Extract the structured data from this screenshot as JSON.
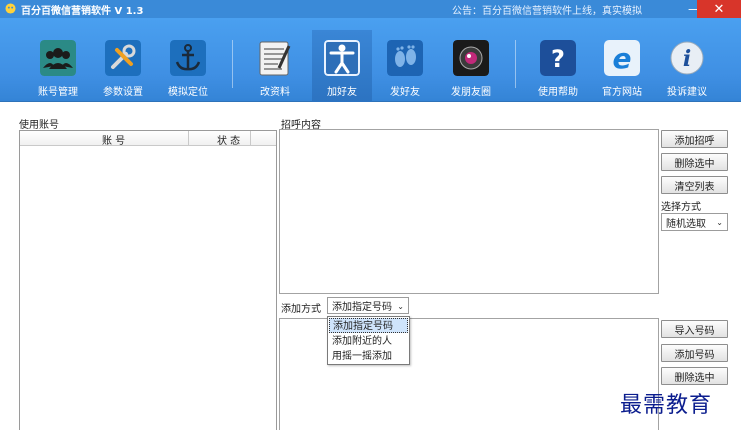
{
  "window": {
    "title": "百分百微信营销软件  V 1.3",
    "notice": "公告：百分百微信营销软件上线，真实模拟",
    "minimize_glyph": "—",
    "close_glyph": "✕"
  },
  "toolbar": {
    "items": [
      {
        "label": "账号管理",
        "icon": "users-icon"
      },
      {
        "label": "参数设置",
        "icon": "wrench-icon"
      },
      {
        "label": "模拟定位",
        "icon": "anchor-icon"
      },
      {
        "label": "改资料",
        "icon": "notepad-icon"
      },
      {
        "label": "加好友",
        "icon": "add-person-icon",
        "active": true
      },
      {
        "label": "发好友",
        "icon": "footprints-icon"
      },
      {
        "label": "发朋友圈",
        "icon": "camera-icon"
      },
      {
        "label": "使用帮助",
        "icon": "help-icon"
      },
      {
        "label": "官方网站",
        "icon": "browser-icon"
      },
      {
        "label": "投诉建议",
        "icon": "info-icon"
      }
    ]
  },
  "accounts": {
    "label": "使用账号",
    "columns": [
      "账  号",
      "状  态"
    ]
  },
  "greeting": {
    "label": "招呼内容",
    "buttons": [
      "添加招呼",
      "删除选中",
      "清空列表"
    ],
    "select_method_label": "选择方式",
    "select_method_value": "随机选取"
  },
  "add_method": {
    "label": "添加方式",
    "value": "添加指定号码",
    "options": [
      "添加指定号码",
      "添加附近的人",
      "用摇一摇添加"
    ]
  },
  "numbers": {
    "buttons": [
      "导入号码",
      "添加号码",
      "删除选中"
    ]
  },
  "watermark": "最需教育",
  "colors": {
    "toolbar": "#3f8fe3",
    "close": "#d8352a",
    "active_tab": "#2c73c1"
  }
}
